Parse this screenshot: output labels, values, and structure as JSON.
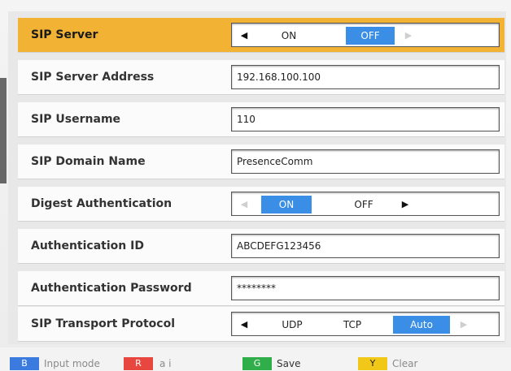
{
  "rows": [
    {
      "label": "SIP Server",
      "type": "select",
      "options": [
        "ON",
        "OFF"
      ],
      "selected": "OFF"
    },
    {
      "label": "SIP Server Address",
      "type": "text",
      "value": "192.168.100.100"
    },
    {
      "label": "SIP Username",
      "type": "text",
      "value": "110"
    },
    {
      "label": "SIP Domain Name",
      "type": "text",
      "value": "PresenceComm"
    },
    {
      "label": "Digest Authentication",
      "type": "select",
      "options": [
        "ON",
        "OFF"
      ],
      "selected": "ON"
    },
    {
      "label": "Authentication ID",
      "type": "text",
      "value": "ABCDEFG123456"
    },
    {
      "label": "Authentication Password",
      "type": "text",
      "value": "********"
    },
    {
      "label": "SIP Transport Protocol",
      "type": "select",
      "options": [
        "UDP",
        "TCP",
        "Auto"
      ],
      "selected": "Auto"
    }
  ],
  "footer": {
    "keys": [
      {
        "key": "B",
        "label": "Input mode",
        "color": "#3b7be0"
      },
      {
        "key": "R",
        "label": "a i",
        "color": "#e8473f"
      },
      {
        "key": "G",
        "label": "Save",
        "color": "#2fae4a"
      },
      {
        "key": "Y",
        "label": "Clear",
        "color": "#f2c818"
      }
    ]
  },
  "colors": {
    "highlight": "#f2b233",
    "active_option": "#3a8ee6"
  }
}
